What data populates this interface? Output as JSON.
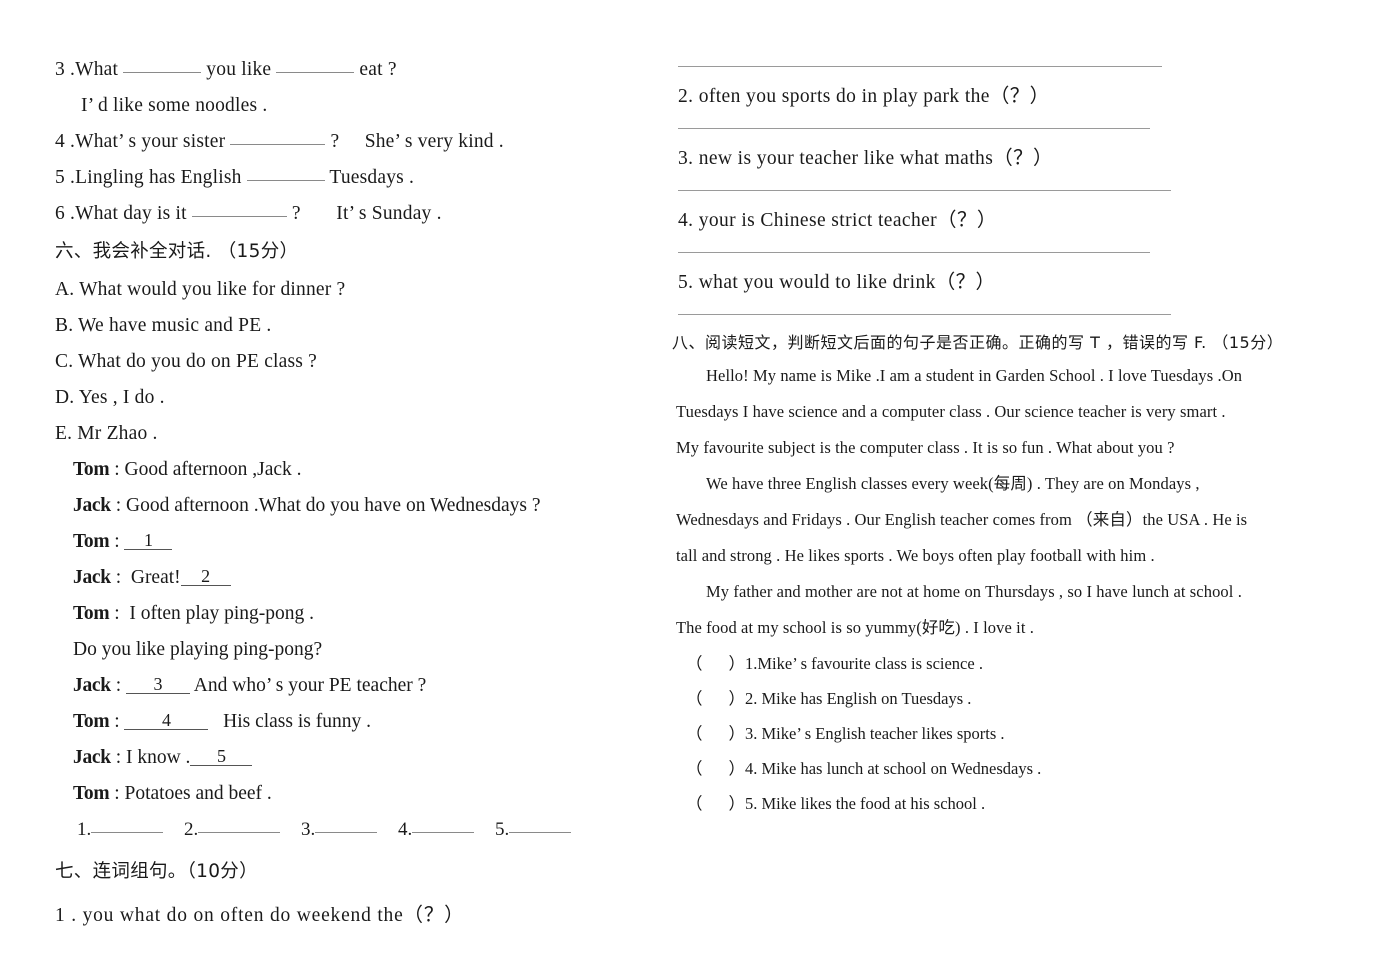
{
  "left_column": {
    "fill_in_items": [
      {
        "id": "item-3",
        "parts": [
          "3 .What",
          "you like",
          "eat ?"
        ],
        "blanks": [
          "",
          ""
        ],
        "answer_line": "I’ d like some noodles ."
      },
      {
        "id": "item-4",
        "text_before": "4  .What’ s your sister",
        "text_after": "?",
        "response": "She’ s very kind ."
      },
      {
        "id": "item-5",
        "text_before": "5 .Lingling has English",
        "text_after": "Tuesdays ."
      },
      {
        "id": "item-6",
        "text_before": "6 .What day is it",
        "text_after": "?",
        "response": "It’ s Sunday ."
      }
    ],
    "section_six": {
      "heading": "六、我会补全对话. （15分）",
      "options": [
        "A.  What would you like for dinner ?",
        "B.  We have music and PE .",
        "C.  What do you do on PE class ?",
        "D.  Yes , I do .",
        "E.  Mr  Zhao ."
      ],
      "dialogue": [
        {
          "speaker": "Tom",
          "colon": ":",
          "text": "Good afternoon ,Jack .",
          "blank": ""
        },
        {
          "speaker": "Jack",
          "colon": ":",
          "text": "Good afternoon .What do you have on Wednesdays ?",
          "blank": ""
        },
        {
          "speaker": "Tom",
          "colon": ":",
          "text": "",
          "blank": "1"
        },
        {
          "speaker": "Jack",
          "colon": ":",
          "text": "Great!",
          "blank": "2"
        },
        {
          "speaker": "Tom",
          "colon": ":",
          "text": "I often play ping-pong .",
          "blank": ""
        },
        {
          "speaker": "",
          "colon": "",
          "text": "Do you like playing ping-pong?",
          "blank": ""
        },
        {
          "speaker": "Jack",
          "colon": ":",
          "text": "And who’ s your PE teacher ?",
          "blank": "3"
        },
        {
          "speaker": "Tom",
          "colon": ":",
          "text": "His class is funny .",
          "blank": "4"
        },
        {
          "speaker": "Jack",
          "colon": ":",
          "text": "I know .",
          "blank": "5"
        },
        {
          "speaker": "Tom",
          "colon": ":",
          "text": "Potatoes and beef .",
          "blank": ""
        }
      ],
      "answer_slots": [
        "1.",
        "2.",
        "3.",
        "4.",
        "5."
      ]
    },
    "section_seven": {
      "heading": "七、连词组句。（10分）",
      "item_1": "1 .  you   what   do   on   often   do   weekend   the（？）"
    }
  },
  "right_column": {
    "word_order_items": [
      "2.  often   you   sports do   in   play   park   the（？）",
      "3.  new   is   your   teacher   like   what   maths（？）",
      "4.  your   is  Chinese   strict  teacher（？）",
      "5.  what   you would to like drink（？）"
    ],
    "section_eight": {
      "heading": "八、阅读短文，判断短文后面的句子是否正确。正确的写 T ，错误的写 F. （15分）",
      "passage_lines": [
        {
          "indent": true,
          "text": "Hello! My name is Mike .I am a student in Garden School . I love Tuesdays .On"
        },
        {
          "indent": false,
          "text": "Tuesdays I have science and a computer class . Our science teacher is very smart ."
        },
        {
          "indent": false,
          "text": "My favourite subject is the computer class . It is so fun . What about you ?"
        },
        {
          "indent": true,
          "text": "We have three English classes every week(每周) . They are on Mondays ,"
        },
        {
          "indent": false,
          "text": "Wednesdays and Fridays . Our English teacher comes from （来自）the USA . He is"
        },
        {
          "indent": false,
          "text": "tall and strong . He likes sports . We boys often play football with him ."
        },
        {
          "indent": true,
          "text": "My father and mother are not at home on Thursdays , so I have lunch at school ."
        },
        {
          "indent": false,
          "text": "The food at my school is so yummy(好吃) . I love it ."
        }
      ],
      "true_false_items": [
        "1.Mike’ s favourite class is science .",
        "2. Mike has English on  Tuesdays .",
        "3. Mike’ s English teacher likes sports .",
        "4. Mike has lunch at school on Wednesdays .",
        "5. Mike likes the food at his school ."
      ]
    }
  }
}
